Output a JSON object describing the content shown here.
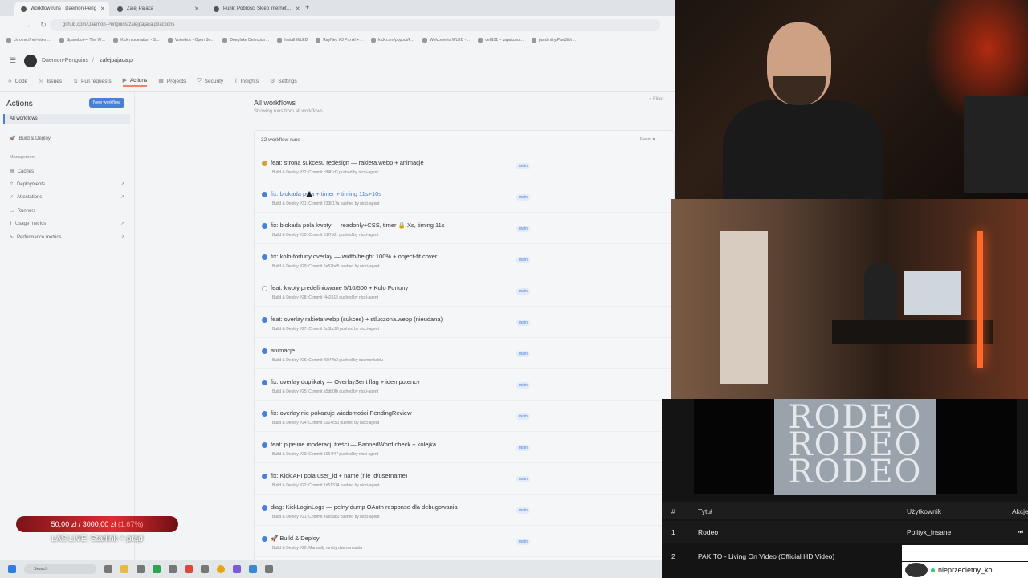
{
  "browser": {
    "tabs": [
      {
        "label": "Workflow runs · Daemon-Peng",
        "active": true
      },
      {
        "label": "Zalej Pajaca",
        "active": false
      },
      {
        "label": "Punkt Pobrości Sklep internet…",
        "active": false
      }
    ],
    "url": "github.com/Daemon-Penguins/zalejpajaca.pl/actions",
    "bookmarks": [
      "chrome://net-intern…",
      "Spaceboi — The W…",
      "Kick moderation - S…",
      "Voicebox - Open So…",
      "Deepfake Detection…",
      "Install WLED",
      "RayNeo X3 Pro AI +…",
      "kick.com/popout/k…",
      "Welcome to WLED -…",
      "cell101 – zapakuko…",
      "justdmitry/PawSith…"
    ]
  },
  "repo": {
    "owner": "Daemon-Penguins",
    "sep": "/",
    "name": "zalejpajaca.pl",
    "nav": [
      "Code",
      "Issues",
      "Pull requests",
      "Actions",
      "Projects",
      "Security",
      "Insights",
      "Settings"
    ]
  },
  "sidebar": {
    "title": "Actions",
    "new_workflow": "New workflow",
    "selected": "All workflows",
    "workflow": "Build & Deploy",
    "management": "Management",
    "items": [
      "Caches",
      "Deployments",
      "Attestations",
      "Runners",
      "Usage metrics",
      "Performance metrics"
    ]
  },
  "main": {
    "title": "All workflows",
    "subtitle": "Showing runs from all workflows",
    "filter": "Filter",
    "count": "32 workflow runs",
    "event_filter": "Event ▾",
    "runs": [
      {
        "title": "feat: strona sukcesu redesign — rakieta.webp + animacje",
        "meta": "Build & Deploy #32: Commit c84f1d3 pushed by nicci-agent",
        "branch": "main",
        "status": "pend"
      },
      {
        "title": "fix: blokada pola + timer + timing 11s+10s",
        "meta": "Build & Deploy #31: Commit 233b17a pushed by nicci-agent",
        "branch": "main",
        "status": "ok",
        "link": true
      },
      {
        "title": "fix: blokada pola kwoty — readonly+CSS, timer 🔒 Xs, timing 11s",
        "meta": "Build & Deploy #30: Commit 51f7b01 pushed by nicci-agent",
        "branch": "main",
        "status": "ok"
      },
      {
        "title": "fix: kolo-fortuny overlay — width/height 100% + object-fit cover",
        "meta": "Build & Deploy #29: Commit 5e52bd5 pushed by nicci-agent",
        "branch": "main",
        "status": "ok"
      },
      {
        "title": "feat: kwoty predefiniowane 5/10/500 + Kolo Fortuny",
        "meta": "Build & Deploy #28: Commit f442515 pushed by nicci-agent",
        "branch": "main",
        "status": "skip"
      },
      {
        "title": "feat: overlay rakieta.webp (sukces) + stluczona.webp (nieudana)",
        "meta": "Build & Deploy #27: Commit 5c8bc90 pushed by nicci-agent",
        "branch": "main",
        "status": "ok"
      },
      {
        "title": "animacje",
        "meta": "Build & Deploy #26: Commit f6847b3 pushed by daemonkablu",
        "branch": "main",
        "status": "ok"
      },
      {
        "title": "fix: overlay duplikaty — OverlaySent flag + idempotency",
        "meta": "Build & Deploy #25: Commit a5db0fb pushed by nicci-agent",
        "branch": "main",
        "status": "ok"
      },
      {
        "title": "fix: overlay nie pokazuje wiadomości PendingReview",
        "meta": "Build & Deploy #24: Commit 6214c50 pushed by nicci-agent",
        "branch": "main",
        "status": "ok"
      },
      {
        "title": "feat: pipeline moderacji treści — BannedWord check + kolejka",
        "meta": "Build & Deploy #23: Commit 5064f47 pushed by nicci-agent",
        "branch": "main",
        "status": "ok"
      },
      {
        "title": "fix: Kick API pola user_id + name (nie id/username)",
        "meta": "Build & Deploy #22: Commit 1d51374 pushed by nicci-agent",
        "branch": "main",
        "status": "ok"
      },
      {
        "title": "diag: KickLoginLogs — pełny dump OAuth response dla debugowania",
        "meta": "Build & Deploy #21: Commit 49e5ab0 pushed by nicci-agent",
        "branch": "main",
        "status": "ok"
      },
      {
        "title": "🚀 Build & Deploy",
        "meta": "Build & Deploy #20: Manually run by daemonkablu",
        "branch": "main",
        "status": "ok"
      }
    ]
  },
  "taskbar": {
    "search": "Search"
  },
  "donation": {
    "current": "50,00 zł",
    "goal": "3000,00 zł",
    "percent": "(1.67%)",
    "sep": "/"
  },
  "last_live": "LAS LIVE: Starlink + prąd",
  "album": {
    "lines": [
      "RODEO",
      "RODEO",
      "RODEO"
    ]
  },
  "playlist": {
    "headers": {
      "num": "#",
      "title": "Tytuł",
      "user": "Użytkownik",
      "actions": "Akcje"
    },
    "rows": [
      {
        "num": "1",
        "title": "Rodeo",
        "user": "Polityk_Insane"
      },
      {
        "num": "2",
        "title": "PAKITO - Living On Video (Official HD Video)",
        "user": ""
      }
    ]
  },
  "chat": {
    "user": "nieprzecietny_ko"
  },
  "colors": {
    "accent": "#4a7fd8",
    "donation": "#e02c31"
  }
}
